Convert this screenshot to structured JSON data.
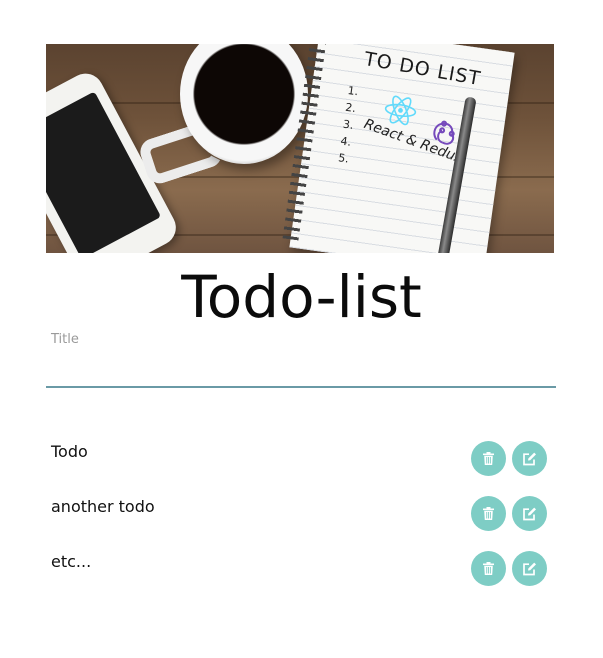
{
  "hero": {
    "notebook_title": "TO DO LIST",
    "notebook_numbers": [
      "1.",
      "2.",
      "3.",
      "4.",
      "5."
    ],
    "notebook_subtitle": "React & Redux"
  },
  "page_title": "Todo-list",
  "title_field": {
    "label": "Title",
    "value": ""
  },
  "todos": [
    {
      "text": "Todo"
    },
    {
      "text": "another todo"
    },
    {
      "text": "etc..."
    }
  ],
  "icons": {
    "delete": "trash-icon",
    "edit": "edit-icon"
  },
  "colors": {
    "accent": "#7ecdc5",
    "input_underline": "#6a9aa6",
    "react_logo": "#61dafb",
    "redux_logo": "#764abc"
  }
}
